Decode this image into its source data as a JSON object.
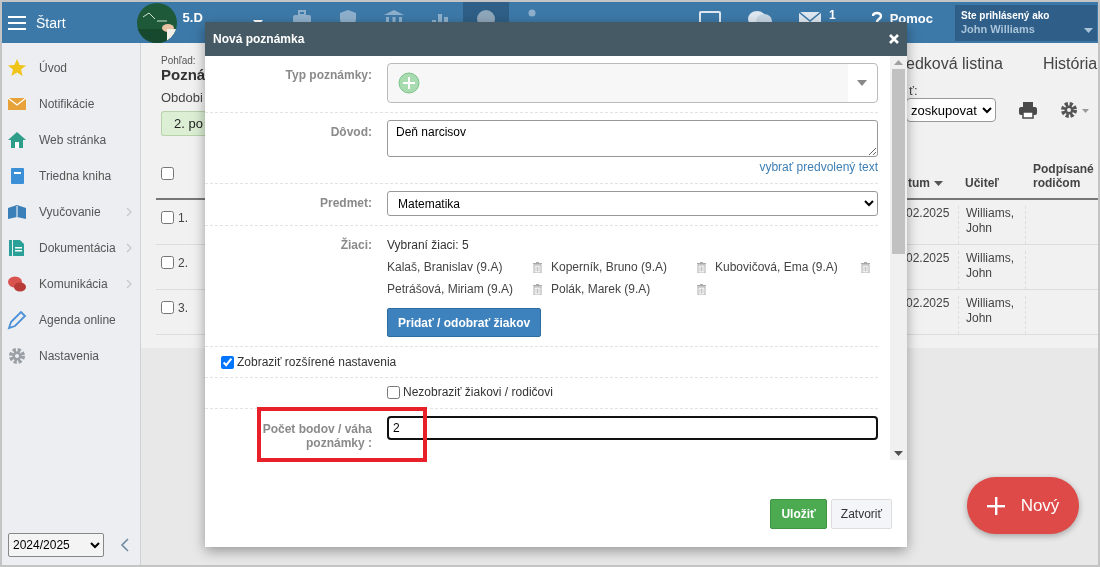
{
  "top_bar": {
    "menu_label": "Štart",
    "class_name": "5.D",
    "nav_icons": [
      {
        "kind": "briefcase",
        "selected": false
      },
      {
        "kind": "shield",
        "selected": false
      },
      {
        "kind": "bank",
        "selected": false
      },
      {
        "kind": "chart",
        "selected": false
      },
      {
        "kind": "circle",
        "selected": true
      },
      {
        "kind": "person",
        "selected": false
      }
    ],
    "mail_count": "1",
    "help_label": "Pomoc",
    "user_box": {
      "caption": "Ste prihlásený ako",
      "name": "John Williams"
    }
  },
  "sidebar": {
    "items": [
      {
        "label": "Úvod",
        "kind": "star",
        "expandable": false
      },
      {
        "label": "Notifikácie",
        "kind": "envelope",
        "expandable": false
      },
      {
        "label": "Web stránka",
        "kind": "house",
        "expandable": false
      },
      {
        "label": "Triedna kniha",
        "kind": "notebook",
        "expandable": false
      },
      {
        "label": "Vyučovanie",
        "kind": "book",
        "expandable": true
      },
      {
        "label": "Dokumentácia",
        "kind": "document",
        "expandable": true
      },
      {
        "label": "Komunikácia",
        "kind": "chat",
        "expandable": true
      },
      {
        "label": "Agenda online",
        "kind": "pen",
        "expandable": false
      },
      {
        "label": "Nastavenia",
        "kind": "gear",
        "expandable": false
      }
    ],
    "school_year": "2024/2025"
  },
  "page": {
    "view_caption": "Pohľad:",
    "view_title": "Pozná",
    "period_label": "Obdobi",
    "period_button": "2. po",
    "tabs": [
      "edková listina",
      "História"
    ],
    "group_label": "ť:",
    "group_select": "zoskupovat",
    "table": {
      "all_checked": false,
      "columns": [
        {
          "label": "tum",
          "sorted": true
        },
        {
          "label": "Učiteľ",
          "sorted": false
        },
        {
          "label": "Podpísané rodičom",
          "sorted": false
        }
      ],
      "rows": [
        {
          "number": "1.",
          "checked": false,
          "date": "02.2025",
          "teacher": "Williams, John"
        },
        {
          "number": "2.",
          "checked": false,
          "date": "02.2025",
          "teacher": "Williams, John"
        },
        {
          "number": "3.",
          "checked": false,
          "date": "02.2025",
          "teacher": "Williams, John"
        }
      ]
    }
  },
  "modal": {
    "title": "Nová poznámka",
    "note_type": {
      "label": "Typ poznámky:"
    },
    "reason": {
      "label": "Dôvod:",
      "value": "Deň narcisov",
      "link": "vybrať predvolený text"
    },
    "subject": {
      "label": "Predmet:",
      "value": "Matematika"
    },
    "students": {
      "label": "Žiaci:",
      "summary": "Vybraní žiaci: 5",
      "list": [
        "Kalaš, Branislav (9.A)",
        "Koperník, Bruno (9.A)",
        "Kubovičová, Ema (9.A)",
        "Petrášová, Miriam (9.A)",
        "Polák, Marek (9.A)"
      ],
      "button": "Pridať / odobrať žiakov"
    },
    "advanced": {
      "label": "Zobraziť rozšírené nastavenia",
      "checked": true
    },
    "hide": {
      "label": "Nezobraziť žiakovi / rodičovi",
      "checked": false
    },
    "points": {
      "label": "Počet bodov / váha poznámky :",
      "value": "2",
      "highlighted": true
    },
    "save_button": "Uložiť",
    "close_button": "Zatvoriť"
  },
  "fab": {
    "label": "Nový"
  }
}
